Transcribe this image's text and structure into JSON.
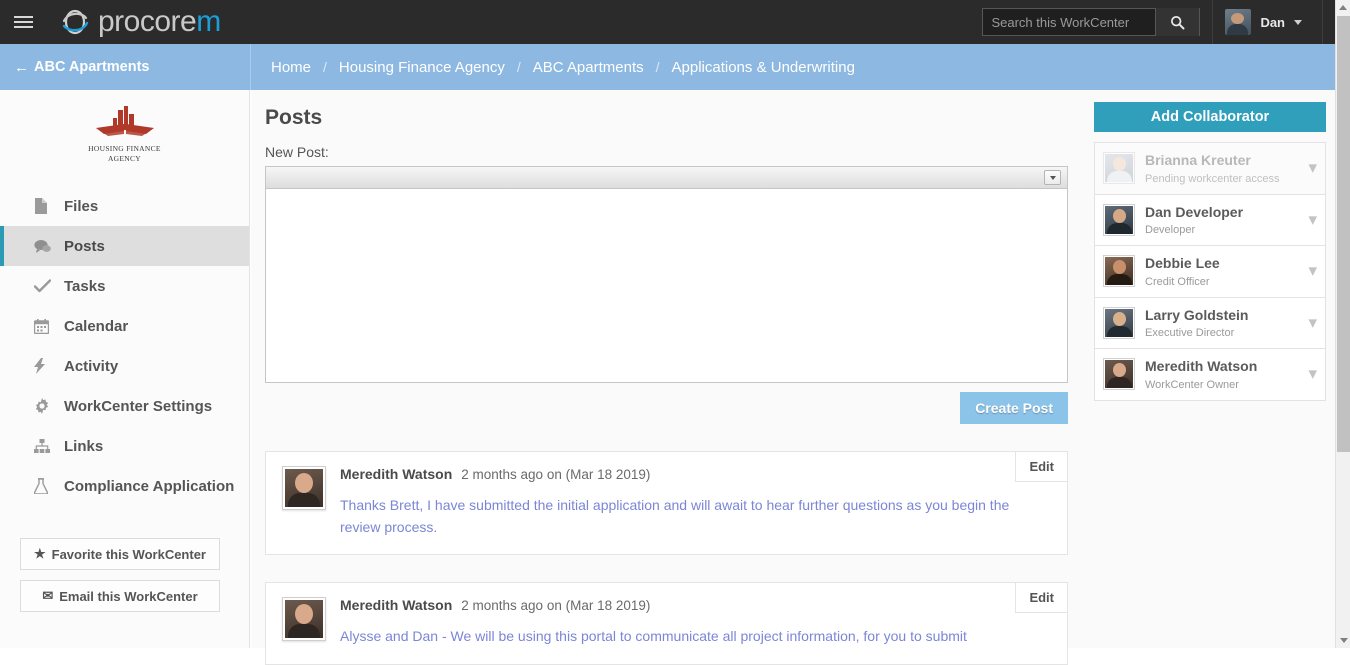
{
  "topbar": {
    "menu_icon": "hamburger-icon",
    "brand": {
      "text_primary": "procore",
      "text_accent": "m"
    },
    "search": {
      "placeholder": "Search this WorkCenter",
      "value": "",
      "icon": "search-icon"
    },
    "user": {
      "name": "Dan",
      "caret": "chevron-down-icon"
    }
  },
  "breadcrumb": {
    "back_label": "ABC Apartments",
    "back_arrow": "arrow-left-icon",
    "separator": "/",
    "items": [
      {
        "label": "Home"
      },
      {
        "label": "Housing Finance Agency"
      },
      {
        "label": "ABC Apartments"
      },
      {
        "label": "Applications & Underwriting"
      }
    ]
  },
  "sidebar": {
    "logo": {
      "caption_line1": "HOUSING FINANCE",
      "caption_line2": "AGENCY",
      "icon": "building-skyline-icon",
      "color": "#b0392a"
    },
    "items": [
      {
        "label": "Files",
        "icon": "file-icon",
        "active": false
      },
      {
        "label": "Posts",
        "icon": "comments-icon",
        "active": true
      },
      {
        "label": "Tasks",
        "icon": "check-icon",
        "active": false
      },
      {
        "label": "Calendar",
        "icon": "calendar-icon",
        "active": false
      },
      {
        "label": "Activity",
        "icon": "bolt-icon",
        "active": false
      },
      {
        "label": "WorkCenter Settings",
        "icon": "gear-icon",
        "active": false
      },
      {
        "label": "Links",
        "icon": "sitemap-icon",
        "active": false
      },
      {
        "label": "Compliance Application",
        "icon": "flask-icon",
        "active": false
      }
    ],
    "buttons": [
      {
        "label": "Favorite this WorkCenter",
        "icon": "star-icon"
      },
      {
        "label": "Email this WorkCenter",
        "icon": "envelope-icon"
      }
    ],
    "active_accent": "#2a9ab5"
  },
  "main": {
    "title": "Posts",
    "new_post_label": "New Post:",
    "editor": {
      "value": "",
      "toolbar_dropdown_icon": "caret-down-icon"
    },
    "create_post_label": "Create Post",
    "create_post_color": "#8cc3e8",
    "edit_label": "Edit",
    "posts": [
      {
        "author": "Meredith Watson",
        "time": "2 months ago on (Mar 18 2019)",
        "body": "Thanks Brett, I have submitted the initial application and will await to hear further questions as you begin the review process.",
        "edit_label": "Edit"
      },
      {
        "author": "Meredith Watson",
        "time": "2 months ago on (Mar 18 2019)",
        "body": "Alysse and Dan - We will be using this portal to communicate all project information, for you to submit",
        "edit_label": "Edit"
      }
    ]
  },
  "right_panel": {
    "add_collaborator_label": "Add Collaborator",
    "add_collaborator_color": "#2f9fbc",
    "collaborators": [
      {
        "name": "Brianna Kreuter",
        "role": "Pending workcenter access",
        "pending": true,
        "avatar_class": "a1",
        "chevron": "chevron-down-icon"
      },
      {
        "name": "Dan Developer",
        "role": "Developer",
        "pending": false,
        "avatar_class": "a2",
        "chevron": "chevron-down-icon"
      },
      {
        "name": "Debbie Lee",
        "role": "Credit Officer",
        "pending": false,
        "avatar_class": "a3",
        "chevron": "chevron-down-icon"
      },
      {
        "name": "Larry Goldstein",
        "role": "Executive Director",
        "pending": false,
        "avatar_class": "a4",
        "chevron": "chevron-down-icon"
      },
      {
        "name": "Meredith Watson",
        "role": "WorkCenter Owner",
        "pending": false,
        "avatar_class": "a5",
        "chevron": "chevron-down-icon"
      }
    ]
  },
  "scrollbar": {
    "up_icon": "scroll-up-icon",
    "down_icon": "scroll-down-icon"
  }
}
